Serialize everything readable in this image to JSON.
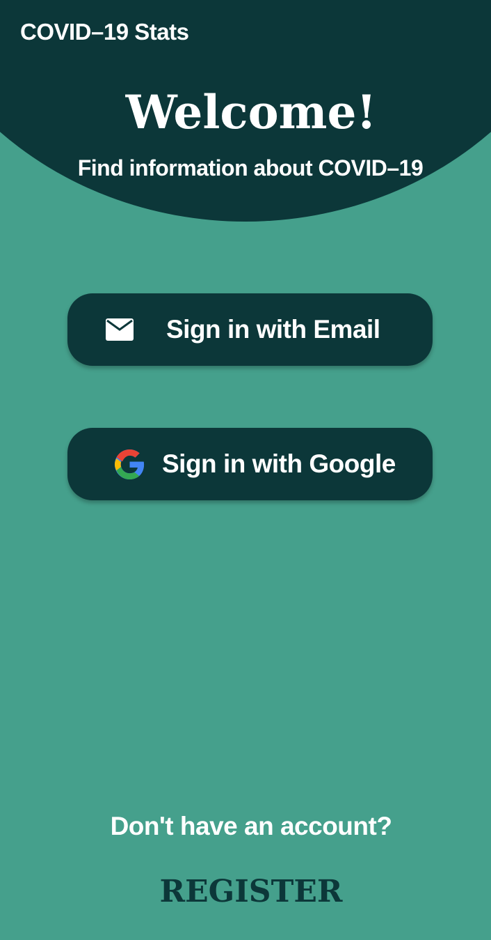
{
  "app": {
    "title": "COVID–19 Stats"
  },
  "header": {
    "welcome": "Welcome!",
    "subtitle": "Find information about COVID–19"
  },
  "buttons": {
    "email": {
      "label": "Sign in with Email",
      "icon": "mail-icon"
    },
    "google": {
      "label": "Sign in with Google",
      "icon": "google-icon"
    }
  },
  "footer": {
    "prompt": "Don't have an account?",
    "register": "REGISTER"
  },
  "colors": {
    "background": "#45a08c",
    "dark": "#0c3739",
    "text": "#ffffff"
  }
}
